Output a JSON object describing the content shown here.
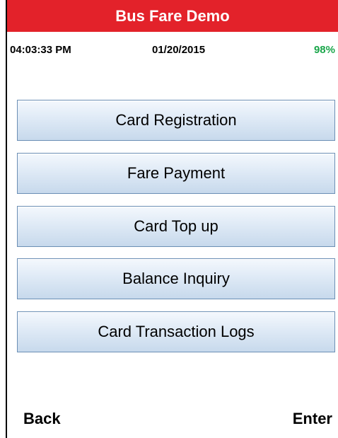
{
  "app": {
    "title": "Bus Fare Demo",
    "title_bar_color": "#e3222a"
  },
  "status_bar": {
    "time": "04:03:33 PM",
    "date": "01/20/2015",
    "battery": "98%",
    "battery_color": "#1aa64a"
  },
  "menu": {
    "items": [
      {
        "label": "Card Registration"
      },
      {
        "label": "Fare Payment"
      },
      {
        "label": "Card Top up"
      },
      {
        "label": "Balance Inquiry"
      },
      {
        "label": "Card Transaction Logs"
      }
    ]
  },
  "softkeys": {
    "left": "Back",
    "right": "Enter"
  }
}
